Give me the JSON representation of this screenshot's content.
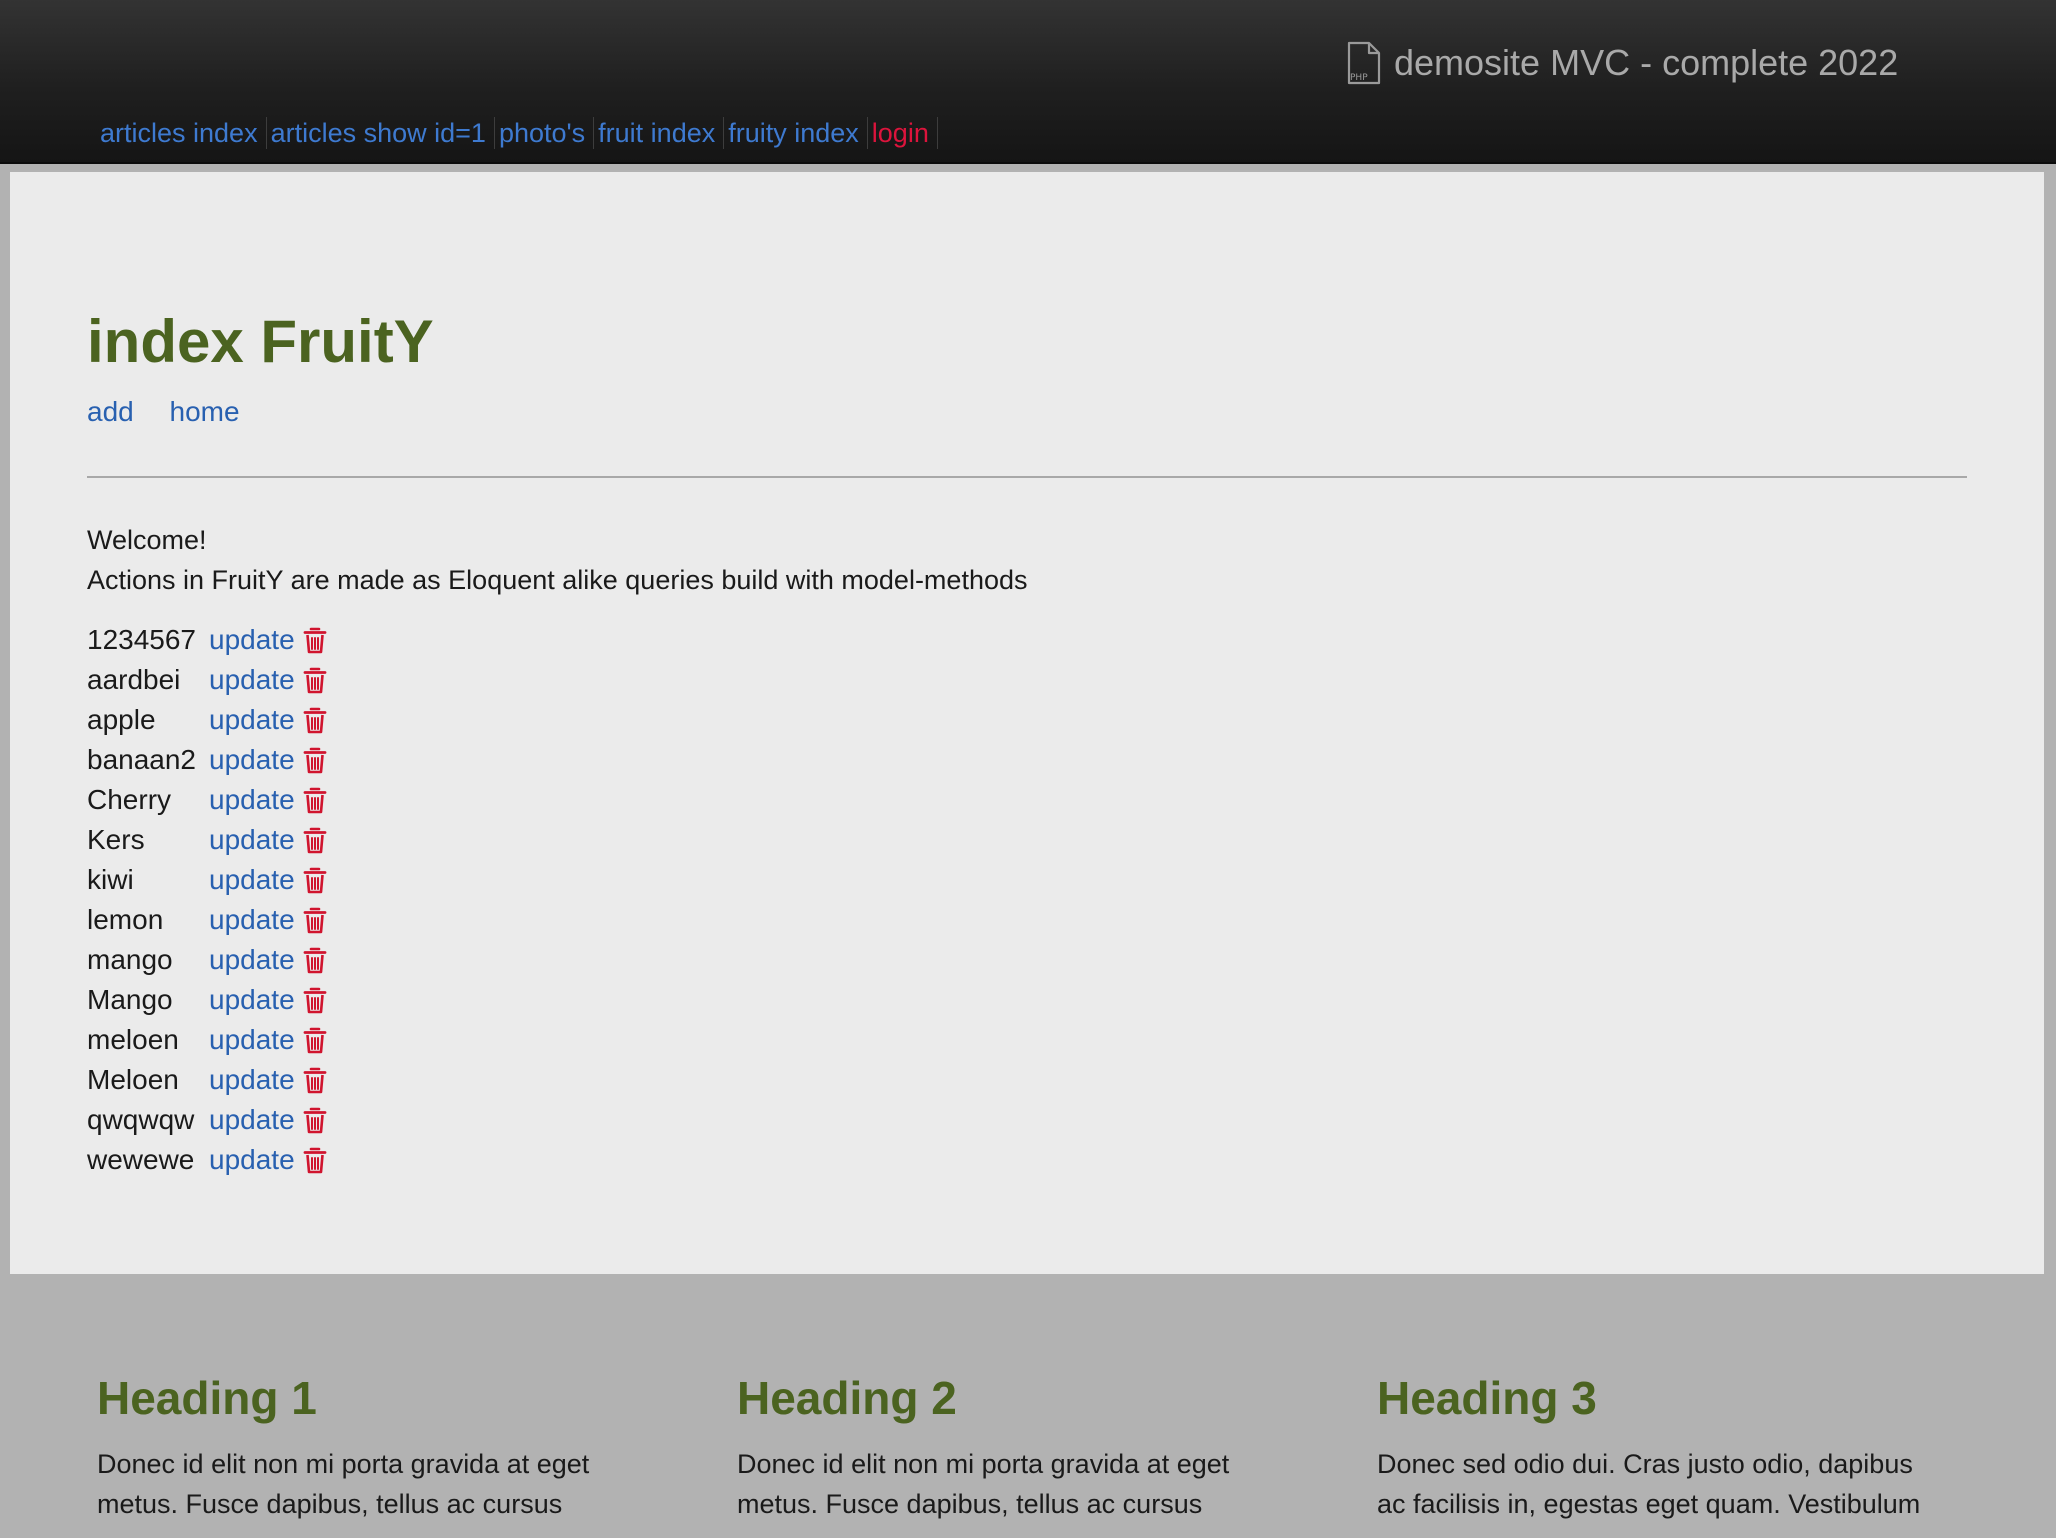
{
  "header": {
    "brand_icon": "php-file-icon",
    "brand_title": "demosite MVC - complete 2022",
    "nav": [
      {
        "label": "articles index"
      },
      {
        "label": "articles show id=1"
      },
      {
        "label": "photo's"
      },
      {
        "label": "fruit index"
      },
      {
        "label": "fruity index"
      },
      {
        "label": "login"
      }
    ],
    "colors": {
      "link": "#3e7ad0",
      "login": "#dc143c"
    }
  },
  "main": {
    "title": "index FruitY",
    "actions": {
      "add": "add",
      "home": "home"
    },
    "intro": {
      "welcome": "Welcome!",
      "description": "Actions in FruitY are made as Eloquent alike queries build with model-methods"
    },
    "update_label": "update",
    "delete_icon": "trash-icon",
    "fruits": [
      {
        "name": "1234567"
      },
      {
        "name": "aardbei"
      },
      {
        "name": "apple"
      },
      {
        "name": "banaan2"
      },
      {
        "name": "Cherry"
      },
      {
        "name": "Kers"
      },
      {
        "name": "kiwi"
      },
      {
        "name": "lemon"
      },
      {
        "name": "mango"
      },
      {
        "name": "Mango"
      },
      {
        "name": "meloen"
      },
      {
        "name": "Meloen"
      },
      {
        "name": "qwqwqw"
      },
      {
        "name": "wewewe"
      }
    ],
    "colors": {
      "heading": "#4b6320",
      "link": "#2860b0",
      "delete": "#d0142e"
    }
  },
  "footer": {
    "columns": [
      {
        "heading": "Heading 1",
        "text": "Donec id elit non mi porta gravida at eget metus. Fusce dapibus, tellus ac cursus"
      },
      {
        "heading": "Heading 2",
        "text": "Donec id elit non mi porta gravida at eget metus. Fusce dapibus, tellus ac cursus"
      },
      {
        "heading": "Heading 3",
        "text": "Donec sed odio dui. Cras justo odio, dapibus ac facilisis in, egestas eget quam. Vestibulum"
      }
    ]
  }
}
